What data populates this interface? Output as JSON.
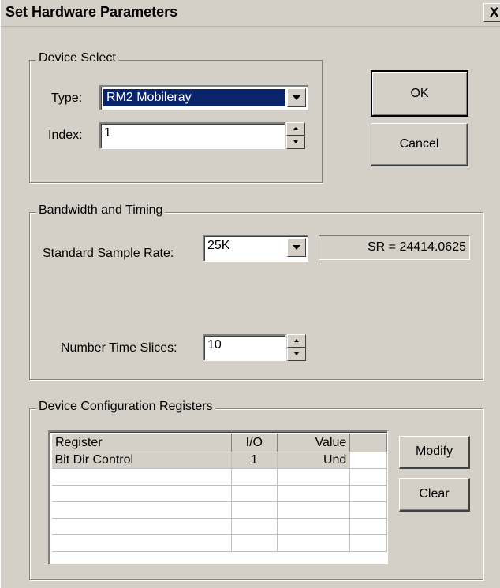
{
  "window": {
    "title": "Set Hardware Parameters",
    "close_glyph": "X"
  },
  "device_select": {
    "group_label": "Device Select",
    "type_label": "Type:",
    "type_value": "RM2  Mobileray",
    "index_label": "Index:",
    "index_value": "1"
  },
  "buttons": {
    "ok": "OK",
    "cancel": "Cancel",
    "modify": "Modify",
    "clear": "Clear"
  },
  "bandwidth": {
    "group_label": "Bandwidth and Timing",
    "sample_rate_label": "Standard Sample Rate:",
    "sample_rate_value": "25K",
    "sr_readout": "SR =  24414.0625",
    "time_slices_label": "Number Time Slices:",
    "time_slices_value": "10"
  },
  "registers": {
    "group_label": "Device Configuration Registers",
    "columns": [
      "Register",
      "I/O",
      "Value",
      ""
    ],
    "rows": [
      [
        "Bit Dir Control",
        "1",
        "Und",
        ""
      ]
    ]
  },
  "colors": {
    "dialog_bg": "#d4d0c8",
    "selection": "#0a246a"
  }
}
